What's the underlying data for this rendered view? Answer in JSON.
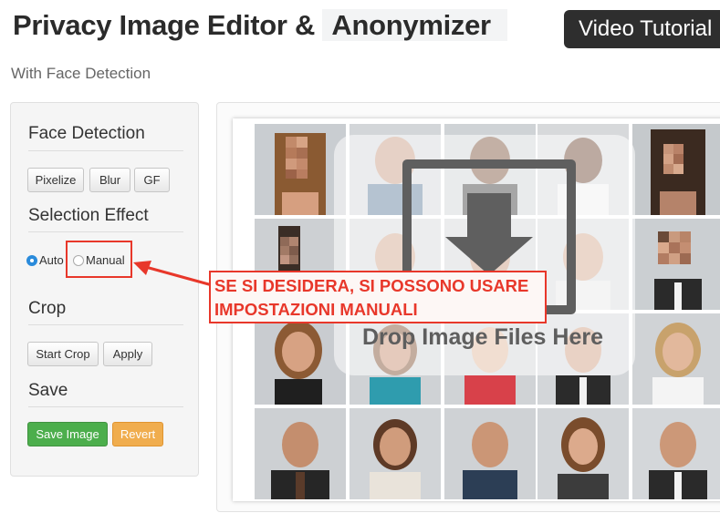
{
  "header": {
    "title_part1": "Privacy Image Editor & ",
    "title_part2": "Anonymizer",
    "video_button": "Video Tutorial",
    "subtitle": "With Face Detection"
  },
  "sidebar": {
    "face_detection": {
      "heading": "Face Detection",
      "buttons": [
        "Pixelize",
        "Blur",
        "GF"
      ]
    },
    "selection_effect": {
      "heading": "Selection Effect",
      "options": [
        "Auto",
        "Manual"
      ],
      "selected": "Auto"
    },
    "crop": {
      "heading": "Crop",
      "buttons": [
        "Start Crop",
        "Apply"
      ]
    },
    "save": {
      "heading": "Save",
      "save_button": "Save Image",
      "revert_button": "Revert"
    }
  },
  "dropzone": {
    "text": "Drop Image Files Here"
  },
  "annotation": {
    "line1": "SE SI DESIDERA, SI POSSONO USARE",
    "line2": "IMPOSTAZIONI MANUALI",
    "color": "#e8372a"
  },
  "colors": {
    "accent_green": "#4cae4c",
    "accent_orange": "#f0ad4e",
    "radio_selected": "#2a8bdb"
  },
  "photo_grid": {
    "columns": 5,
    "rows": 4,
    "pixelated_faces": [
      "row1-col1",
      "row1-col5",
      "row2-col1",
      "row2-col5"
    ]
  }
}
